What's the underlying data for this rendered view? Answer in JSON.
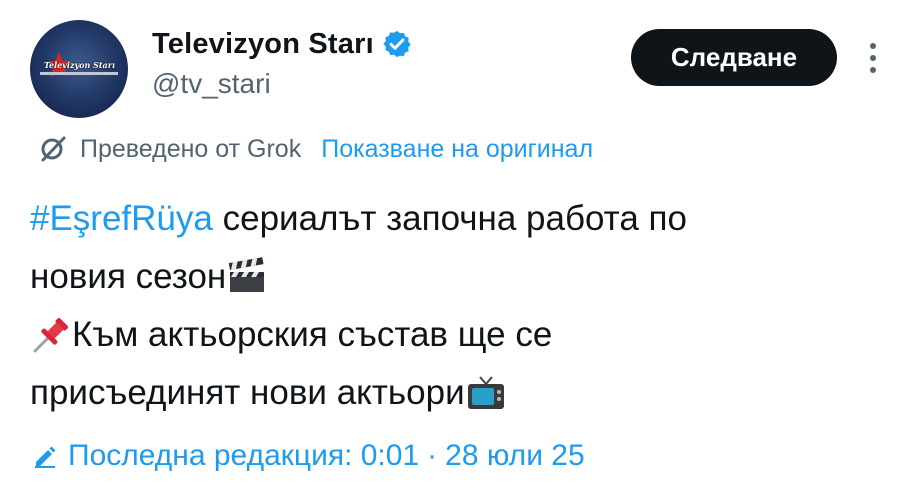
{
  "account": {
    "display_name": "Televizyon Starı",
    "handle": "@tv_stari",
    "avatar_logo_text": "Televizyon Starı",
    "verified": true,
    "verified_color": "#1d9bf0"
  },
  "actions": {
    "follow_label": "Следване",
    "more_icon": "more-vertical-icon"
  },
  "translation": {
    "icon": "grok-icon",
    "translated_by": "Преведено от Grok",
    "show_original": "Показване на оригинал"
  },
  "post": {
    "hashtag": "#EşrefRüya",
    "line1_rest": " сериалът започна работа по",
    "line2": "новия сезон",
    "line2_emoji": "clapper-board-emoji",
    "line3_emoji": "pushpin-emoji",
    "line3": "Към актьорския състав ще се",
    "line4": "присъединят нови актьори",
    "line4_emoji": "television-emoji"
  },
  "edit": {
    "icon": "pencil-icon",
    "label": "Последна редакция: 0:01",
    "separator": "·",
    "date": "28 юли 25"
  },
  "colors": {
    "text": "#0f1419",
    "secondary": "#536471",
    "link": "#1d9bf0",
    "button_bg": "#0f1419",
    "button_text": "#ffffff"
  }
}
